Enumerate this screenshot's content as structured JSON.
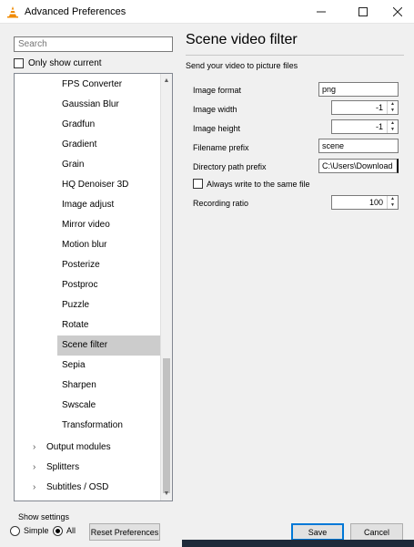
{
  "window": {
    "title": "Advanced Preferences",
    "icon": "vlc-cone-icon",
    "controls": [
      "minimize",
      "maximize",
      "close"
    ]
  },
  "search": {
    "placeholder": "Search",
    "value": ""
  },
  "only_show_current": {
    "label": "Only show current",
    "checked": false
  },
  "tree": {
    "items": [
      {
        "label": "FPS Converter",
        "level": "sub",
        "selected": false
      },
      {
        "label": "Gaussian Blur",
        "level": "sub",
        "selected": false
      },
      {
        "label": "Gradfun",
        "level": "sub",
        "selected": false
      },
      {
        "label": "Gradient",
        "level": "sub",
        "selected": false
      },
      {
        "label": "Grain",
        "level": "sub",
        "selected": false
      },
      {
        "label": "HQ Denoiser 3D",
        "level": "sub",
        "selected": false
      },
      {
        "label": "Image adjust",
        "level": "sub",
        "selected": false
      },
      {
        "label": "Mirror video",
        "level": "sub",
        "selected": false
      },
      {
        "label": "Motion blur",
        "level": "sub",
        "selected": false
      },
      {
        "label": "Posterize",
        "level": "sub",
        "selected": false
      },
      {
        "label": "Postproc",
        "level": "sub",
        "selected": false
      },
      {
        "label": "Puzzle",
        "level": "sub",
        "selected": false
      },
      {
        "label": "Rotate",
        "level": "sub",
        "selected": false
      },
      {
        "label": "Scene filter",
        "level": "sub",
        "selected": true
      },
      {
        "label": "Sepia",
        "level": "sub",
        "selected": false
      },
      {
        "label": "Sharpen",
        "level": "sub",
        "selected": false
      },
      {
        "label": "Swscale",
        "level": "sub",
        "selected": false
      },
      {
        "label": "Transformation",
        "level": "sub",
        "selected": false
      },
      {
        "label": "Output modules",
        "level": "top",
        "selected": false
      },
      {
        "label": "Splitters",
        "level": "top",
        "selected": false
      },
      {
        "label": "Subtitles / OSD",
        "level": "top",
        "selected": false
      }
    ]
  },
  "panel": {
    "title": "Scene video filter",
    "subtitle": "Send your video to picture files",
    "fields": {
      "image_format": {
        "label": "Image format",
        "value": "png"
      },
      "image_width": {
        "label": "Image width",
        "value": "-1"
      },
      "image_height": {
        "label": "Image height",
        "value": "-1"
      },
      "filename_prefix": {
        "label": "Filename prefix",
        "value": "scene"
      },
      "directory_path_prefix": {
        "label": "Directory path prefix",
        "value": "C:\\Users\\Download"
      },
      "always_write": {
        "label": "Always write to the same file",
        "checked": false
      },
      "recording_ratio": {
        "label": "Recording ratio",
        "value": "100"
      }
    }
  },
  "show_settings": {
    "label": "Show settings",
    "simple": "Simple",
    "all": "All",
    "selected": "All"
  },
  "buttons": {
    "reset": "Reset Preferences",
    "save": "Save",
    "cancel": "Cancel"
  }
}
